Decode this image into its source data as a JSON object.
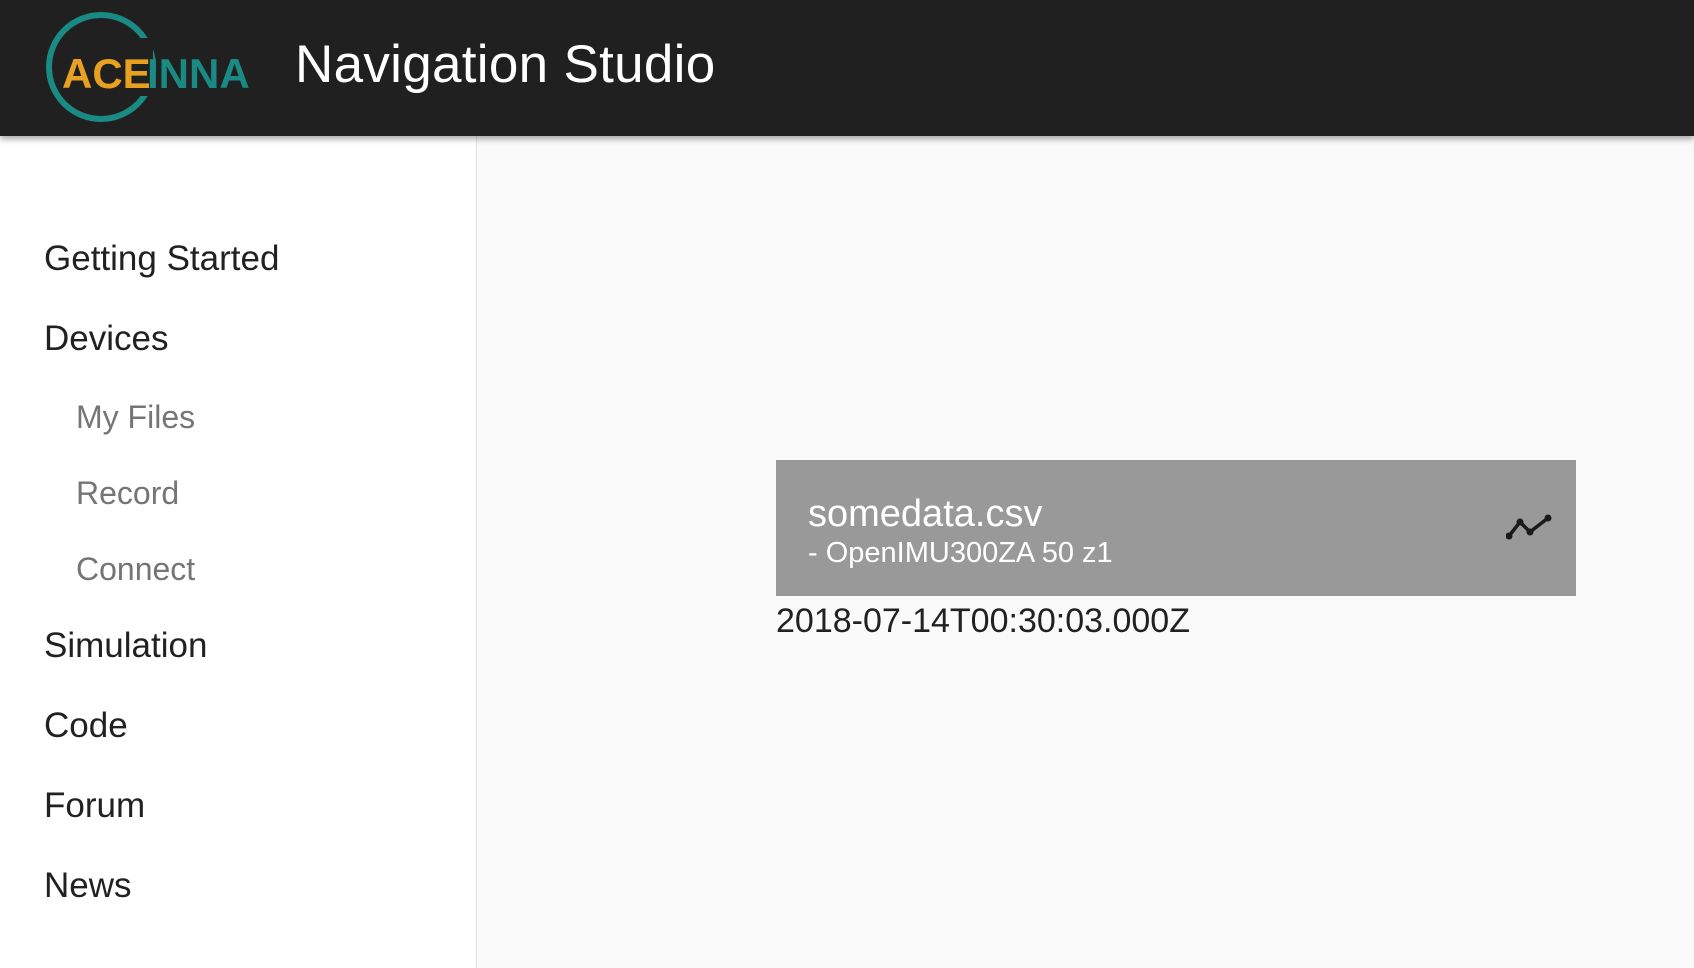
{
  "header": {
    "logo_text_ace": "ACE",
    "logo_text_inna": "INNA",
    "title": "Navigation Studio",
    "colors": {
      "bar": "#202020",
      "logo_ring": "#1a8a84",
      "logo_ace": "#e8a020",
      "logo_inna": "#1a8a84"
    }
  },
  "sidebar": {
    "items": [
      {
        "label": "Getting Started"
      },
      {
        "label": "Devices"
      },
      {
        "label": "My Files"
      },
      {
        "label": "Record"
      },
      {
        "label": "Connect"
      },
      {
        "label": "Simulation"
      },
      {
        "label": "Code"
      },
      {
        "label": "Forum"
      },
      {
        "label": "News"
      }
    ]
  },
  "main": {
    "file": {
      "name": "somedata.csv",
      "subtitle": "- OpenIMU300ZA 50 z1",
      "icon": "show-chart-icon",
      "date": "2018-07-14T00:30:03.000Z"
    }
  }
}
